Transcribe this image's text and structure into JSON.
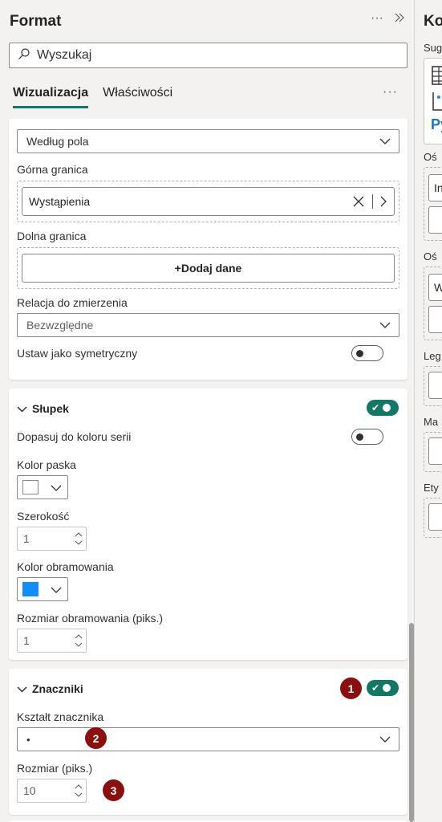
{
  "pane": {
    "title": "Format",
    "search_placeholder": "Wyszukaj",
    "tabs": [
      "Wizualizacja",
      "Właściwości"
    ],
    "more": "···"
  },
  "error_bars": {
    "type_value": "Według pola",
    "upper_label": "Górna granica",
    "upper_field": "Wystąpienia",
    "lower_label": "Dolna granica",
    "lower_add": "+Dodaj dane",
    "relation_label": "Relacja do zmierzenia",
    "relation_value": "Bezwzględne",
    "symmetric_label": "Ustaw jako symetryczny"
  },
  "bar_section": {
    "title": "Słupek",
    "match_label": "Dopasuj do koloru serii",
    "bar_color_label": "Kolor paska",
    "bar_color": "#ffffff",
    "width_label": "Szerokość",
    "width_value": "1",
    "border_color_label": "Kolor obramowania",
    "border_color": "#118dff",
    "border_size_label": "Rozmiar obramowania (piks.)",
    "border_size_value": "1"
  },
  "markers_section": {
    "title": "Znaczniki",
    "shape_label": "Kształt znacznika",
    "shape_value": "•",
    "size_label": "Rozmiar (piks.)",
    "size_value": "10"
  },
  "badges": [
    "1",
    "2",
    "3"
  ],
  "side": {
    "title": "Ko",
    "labels": [
      "Sug",
      "Oś",
      "Oś",
      "Leg",
      "Ma",
      "Ety"
    ],
    "box_text_1": "In",
    "box_text_2": "W",
    "py_text": "Py"
  },
  "colors": {
    "accent": "#117865",
    "badge": "#8b0f0f"
  }
}
